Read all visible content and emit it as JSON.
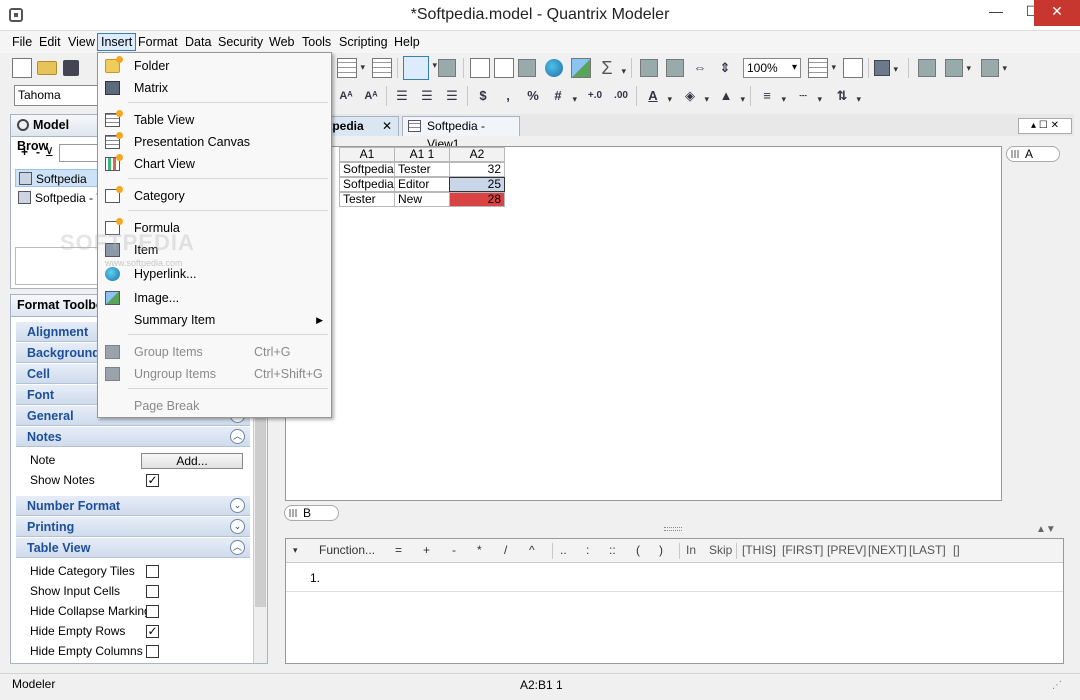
{
  "window": {
    "title": "*Softpedia.model - Quantrix Modeler",
    "min": "—",
    "max": "☐",
    "close": "✕"
  },
  "menubar": [
    "File",
    "Edit",
    "View",
    "Insert",
    "Format",
    "Data",
    "Security",
    "Web",
    "Tools",
    "Scripting",
    "Help"
  ],
  "toolbar": {
    "zoom": "100%",
    "font": "Tahoma",
    "sigma": "Σ",
    "dollar": "$",
    "comma": ",",
    "percent": "%",
    "hash": "#",
    "dec_inc": "+.0",
    "dec_dec": ".00",
    "font_small": "Aᴬ",
    "font_large": "Aᴬ"
  },
  "insert_menu": {
    "items": [
      {
        "label": "Folder",
        "icon": "folder-icon"
      },
      {
        "label": "Matrix",
        "icon": "matrix-icon"
      },
      {
        "label": "Table View",
        "icon": "table-view-icon"
      },
      {
        "label": "Presentation Canvas",
        "icon": "presentation-canvas-icon"
      },
      {
        "label": "Chart View",
        "icon": "chart-view-icon"
      },
      {
        "label": "Category",
        "icon": "category-icon"
      },
      {
        "label": "Formula",
        "icon": "formula-icon"
      },
      {
        "label": "Item",
        "icon": "item-icon"
      },
      {
        "label": "Hyperlink...",
        "icon": "hyperlink-icon"
      },
      {
        "label": "Image...",
        "icon": "image-icon"
      },
      {
        "label": "Summary Item",
        "icon": ""
      },
      {
        "label": "Group Items",
        "shortcut": "Ctrl+G",
        "icon": "group-items-icon"
      },
      {
        "label": "Ungroup Items",
        "shortcut": "Ctrl+Shift+G",
        "icon": "ungroup-items-icon"
      },
      {
        "label": "Page Break",
        "icon": ""
      }
    ]
  },
  "model_browser": {
    "title": "Model Brow",
    "plus": "+",
    "minus": "-",
    "items": [
      "Softpedia",
      "Softpedia - View1"
    ]
  },
  "format_toolbox": {
    "title": "Format Toolbo",
    "sections": [
      "Alignment",
      "Background",
      "Cell",
      "Font",
      "General",
      "Notes",
      "Number Format",
      "Printing",
      "Table View"
    ],
    "notes": {
      "note_label": "Note",
      "add_button": "Add...",
      "show_notes": "Show Notes"
    },
    "table_view": [
      "Hide Category Tiles",
      "Show Input Cells",
      "Hide Collapse Marking",
      "Hide Empty Rows",
      "Hide Empty Columns"
    ]
  },
  "tabs": [
    "Softpedia",
    "Softpedia - View1"
  ],
  "sheet": {
    "headers": [
      "A1",
      "A1 1",
      "A2"
    ],
    "rows": [
      [
        "Softpedia",
        "Tester",
        "32"
      ],
      [
        "Softpedia",
        "Editor",
        "25"
      ],
      [
        "Tester",
        "New",
        "28"
      ]
    ],
    "tile_a": "A",
    "tile_b": "B",
    "highlight_color": "#d94343",
    "selected_color": "#c9d6e8"
  },
  "formula_bar": {
    "function_label": "Function...",
    "ops": [
      "=",
      "+",
      "-",
      "*",
      "/",
      "^",
      "..",
      ":",
      "::",
      "(",
      ")"
    ],
    "keywords": [
      "In",
      "Skip",
      "[THIS]",
      "[FIRST]",
      "[PREV]",
      "[NEXT]",
      "[LAST]",
      "[]"
    ],
    "line_number": "1."
  },
  "statusbar": {
    "left": "Modeler",
    "center": "A2:B1 1"
  },
  "watermark": {
    "big": "SOFTPEDIA",
    "small": "www.softpedia.com"
  }
}
